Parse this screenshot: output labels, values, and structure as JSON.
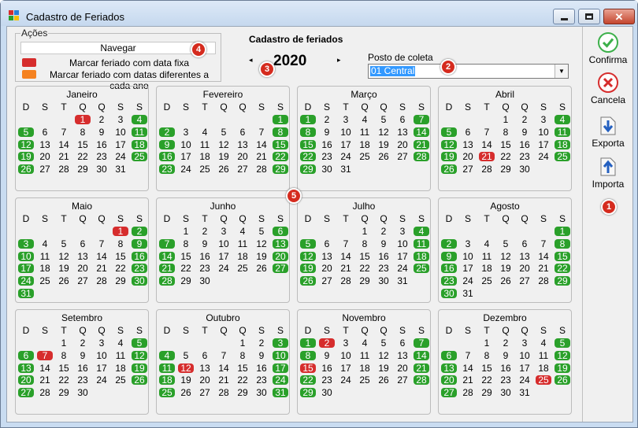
{
  "window": {
    "title": "Cadastro de Feriados"
  },
  "acoes": {
    "legend": "Ações",
    "navigate_label": "Navegar",
    "fixed_label": "Marcar feriado com data fixa",
    "variable_label": "Marcar feriado com datas diferentes a cada ano",
    "fixed_color": "#d62d2d",
    "variable_color": "#f58220"
  },
  "header": {
    "title": "Cadastro de feriados",
    "year": "2020",
    "prev": "◂",
    "next": "▸"
  },
  "posto": {
    "label": "Posto de coleta",
    "value": "01 Central"
  },
  "weekdays": [
    "D",
    "S",
    "T",
    "Q",
    "Q",
    "S",
    "S"
  ],
  "colors": {
    "weekend": "#2aa02a",
    "holiday": "#d62d2d"
  },
  "months": [
    {
      "name": "Janeiro",
      "start": 3,
      "days": 31,
      "holidays": [
        1
      ]
    },
    {
      "name": "Fevereiro",
      "start": 6,
      "days": 29,
      "holidays": []
    },
    {
      "name": "Março",
      "start": 0,
      "days": 31,
      "holidays": []
    },
    {
      "name": "Abril",
      "start": 3,
      "days": 30,
      "holidays": [
        21
      ]
    },
    {
      "name": "Maio",
      "start": 5,
      "days": 31,
      "holidays": [
        1
      ]
    },
    {
      "name": "Junho",
      "start": 1,
      "days": 30,
      "holidays": []
    },
    {
      "name": "Julho",
      "start": 3,
      "days": 31,
      "holidays": []
    },
    {
      "name": "Agosto",
      "start": 6,
      "days": 31,
      "holidays": []
    },
    {
      "name": "Setembro",
      "start": 2,
      "days": 30,
      "holidays": [
        7
      ]
    },
    {
      "name": "Outubro",
      "start": 4,
      "days": 31,
      "holidays": [
        12
      ]
    },
    {
      "name": "Novembro",
      "start": 0,
      "days": 30,
      "holidays": [
        2,
        15
      ]
    },
    {
      "name": "Dezembro",
      "start": 2,
      "days": 31,
      "holidays": [
        25
      ]
    }
  ],
  "sidebar": {
    "confirm": "Confirma",
    "cancel": "Cancela",
    "export": "Exporta",
    "import": "Importa"
  },
  "badges": [
    "1",
    "2",
    "3",
    "4",
    "5"
  ]
}
